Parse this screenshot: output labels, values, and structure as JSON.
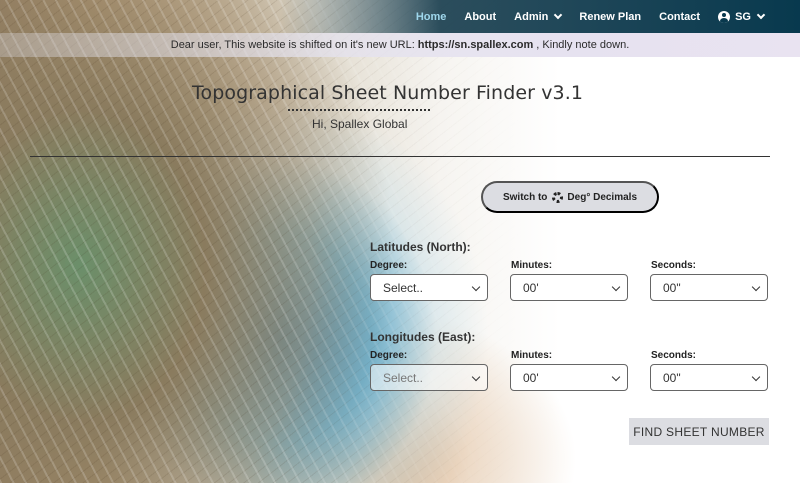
{
  "nav": {
    "items": [
      {
        "label": "Home",
        "active": true
      },
      {
        "label": "About"
      },
      {
        "label": "Admin",
        "dropdown": true
      },
      {
        "label": "Renew Plan"
      },
      {
        "label": "Contact"
      },
      {
        "label": "SG",
        "dropdown": true,
        "icon": "user-circle-icon"
      }
    ],
    "accent_color": "#08394e"
  },
  "notice": {
    "prefix": "Dear user, This website is shifted on it's new URL:",
    "url": "https://sn.spallex.com",
    "suffix": ", Kindly note down."
  },
  "header": {
    "title": "Topographical Sheet Number Finder v3.1",
    "greeting": "Hi, Spallex Global"
  },
  "toggle": {
    "prefix": "Switch to",
    "icon": "gear-icon",
    "label": "Deg° Decimals"
  },
  "latitude": {
    "title": "Latitudes (North):",
    "degree_label": "Degree:",
    "minutes_label": "Minutes:",
    "seconds_label": "Seconds:",
    "degree_value": "Select..",
    "minutes_value": "00'",
    "seconds_value": "00\""
  },
  "longitude": {
    "title": "Longitudes (East):",
    "degree_label": "Degree:",
    "minutes_label": "Minutes:",
    "seconds_label": "Seconds:",
    "degree_value": "Select..",
    "minutes_value": "00'",
    "seconds_value": "00\""
  },
  "actions": {
    "find_label": "FIND SHEET NUMBER"
  }
}
